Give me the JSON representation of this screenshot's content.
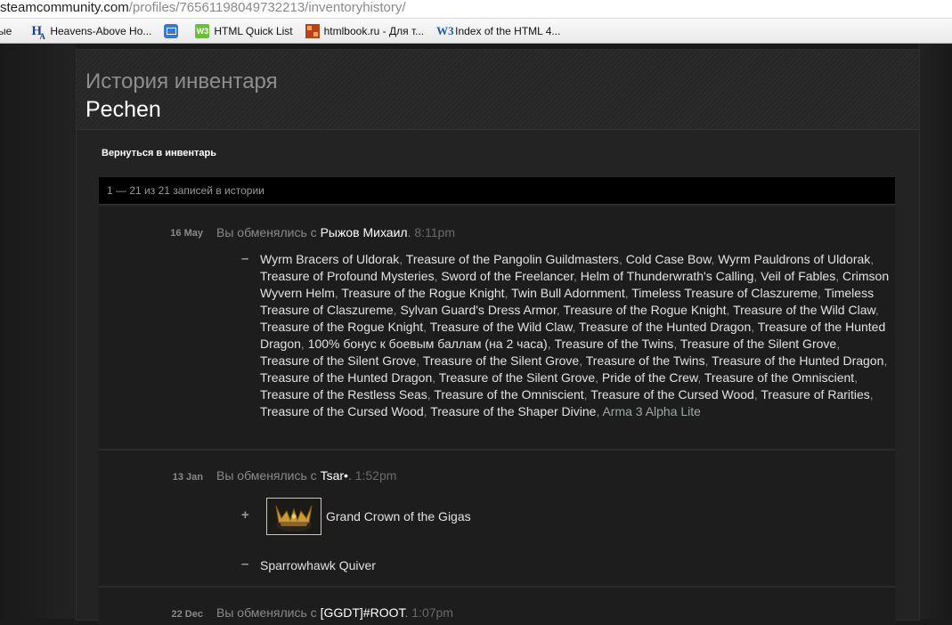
{
  "browser": {
    "url_host": "steamcommunity.com",
    "url_path": "/profiles/76561198049732213/inventoryhistory/",
    "bookmarks": [
      {
        "label": "ые",
        "icon": "none"
      },
      {
        "label": "Heavens-Above Ho...",
        "icon": "heavens-above-icon"
      },
      {
        "label": "",
        "icon": "mail-icon"
      },
      {
        "label": "HTML Quick List",
        "icon": "w3c-icon"
      },
      {
        "label": "htmlbook.ru - Для т...",
        "icon": "htmlbook-icon"
      },
      {
        "label": "Index of the HTML 4...",
        "icon": "w3-icon"
      }
    ]
  },
  "page": {
    "title": "История инвентаря",
    "username": "Pechen",
    "back_link": "Вернуться в инвентарь",
    "count_text": "1 — 21 из 21 записей в истории"
  },
  "history": [
    {
      "date": "16 May",
      "action": "Вы обменялись с",
      "user": "Рыжов Михаил",
      "time": "8:11pm",
      "sign": "–",
      "items": [
        "Wyrm Bracers of Uldorak",
        "Treasure of the Pangolin Guildmasters",
        "Cold Case Bow",
        "Wyrm Pauldrons of Uldorak",
        "Treasure of Profound Mysteries",
        "Sword of the Freelancer",
        "Helm of Thunderwrath's Calling",
        "Veil of Fables",
        "Crimson Wyvern Helm",
        "Treasure of the Rogue Knight",
        "Twin Bull Adornment",
        "Timeless Treasure of Claszureme",
        "Timeless Treasure of Claszureme",
        "Sylvan Guard's Dress Armor",
        "Treasure of the Rogue Knight",
        "Treasure of the Wild Claw",
        "Treasure of the Rogue Knight",
        "Treasure of the Wild Claw",
        "Treasure of the Hunted Dragon",
        "Treasure of the Hunted Dragon",
        "100% бонус к боевым баллам (на 2 часа)",
        "Treasure of the Twins",
        "Treasure of the Silent Grove",
        "Treasure of the Silent Grove",
        "Treasure of the Silent Grove",
        "Treasure of the Twins",
        "Treasure of the Hunted Dragon",
        "Treasure of the Hunted Dragon",
        "Treasure of the Silent Grove",
        "Pride of the Crew",
        "Treasure of the Omniscient",
        "Treasure of the Restless Seas",
        "Treasure of the Omniscient",
        "Treasure of the Cursed Wood",
        "Treasure of Rarities",
        "Treasure of the Cursed Wood",
        "Treasure of the Shaper Divine"
      ],
      "last_item": "Arma 3 Alpha Lite"
    },
    {
      "date": "13 Jan",
      "action": "Вы обменялись с",
      "user": "Tsar•",
      "time": "1:52pm",
      "received_sign": "+",
      "received_item": "Grand Crown of the Gigas",
      "received_icon": "crown-icon",
      "given_sign": "–",
      "given_item": "Sparrowhawk Quiver"
    },
    {
      "date": "22 Dec",
      "action": "Вы обменялись с",
      "user": "[GGDT]#ROOT",
      "time": "1:07pm"
    }
  ]
}
